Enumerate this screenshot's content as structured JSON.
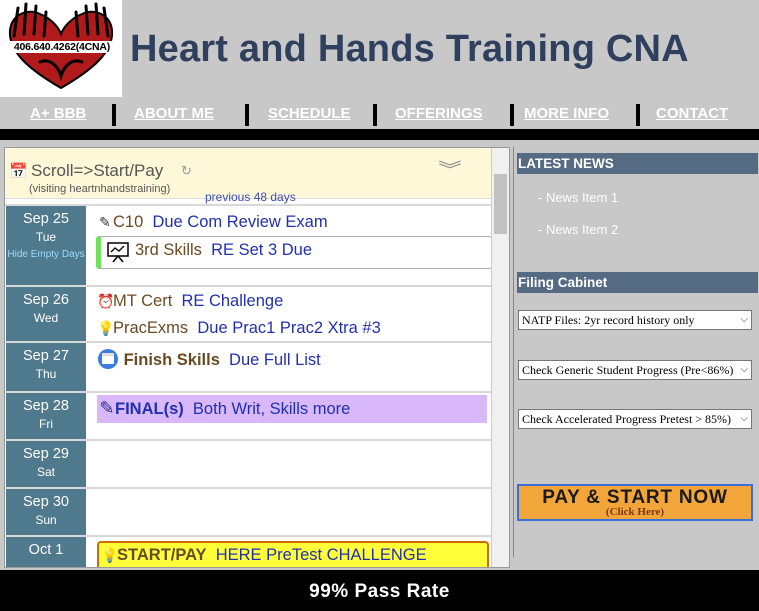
{
  "logo": {
    "phone": "406.640.4262(4CNA)"
  },
  "site": {
    "title": "Heart and Hands Training CNA"
  },
  "nav": [
    "A+ BBB",
    "ABOUT ME",
    "SCHEDULE",
    "OFFERINGS",
    "MORE INFO",
    "CONTACT"
  ],
  "calendar": {
    "title": "Scroll=>Start/Pay",
    "subtitle": "(visiting heartnhandstraining)",
    "previous_label": "previous 48 days",
    "hide_empty": "Hide Empty Days",
    "days": [
      {
        "date": "Sep 25",
        "dow": "Tue"
      },
      {
        "date": "Sep 26",
        "dow": "Wed"
      },
      {
        "date": "Sep 27",
        "dow": "Thu"
      },
      {
        "date": "Sep 28",
        "dow": "Fri"
      },
      {
        "date": "Sep 29",
        "dow": "Sat"
      },
      {
        "date": "Sep 30",
        "dow": "Sun"
      },
      {
        "date": "Oct 1",
        "dow": ""
      }
    ],
    "events": {
      "e1": {
        "cat": "C10",
        "desc": "Due Com Review Exam"
      },
      "e2": {
        "cat": "3rd Skills",
        "desc": "RE Set 3 Due"
      },
      "e3": {
        "cat": "MT Cert",
        "desc": "RE Challenge"
      },
      "e4": {
        "cat": "PracExms",
        "desc": "Due Prac1 Prac2 Xtra #3"
      },
      "e5": {
        "cat": "Finish Skills",
        "desc": "Due Full List"
      },
      "e6": {
        "cat": "FINAL(s)",
        "desc": "Both Writ, Skills more"
      },
      "e7": {
        "cat": "START/PAY",
        "desc": "HERE PreTest CHALLENGE"
      }
    }
  },
  "sidebar": {
    "latest_news": "LATEST NEWS",
    "news": [
      "- News Item 1",
      "- News Item 2"
    ],
    "filing": "Filing Cabinet",
    "selects": [
      "NATP Files: 2yr record history only",
      "Check Generic Student Progress (Pre<86%)",
      "Check Accelerated Progress Pretest > 85%)"
    ]
  },
  "pay": {
    "main": "PAY & START NOW",
    "sub": "(Click Here)"
  },
  "footer": {
    "text": "99% Pass Rate"
  },
  "colors": {
    "title": "#2f3f5e",
    "nav_bg": "#c8c8c8",
    "day_label": "#4f7a8e",
    "side_head": "#556a83",
    "pay_button": "#f2a63a"
  }
}
